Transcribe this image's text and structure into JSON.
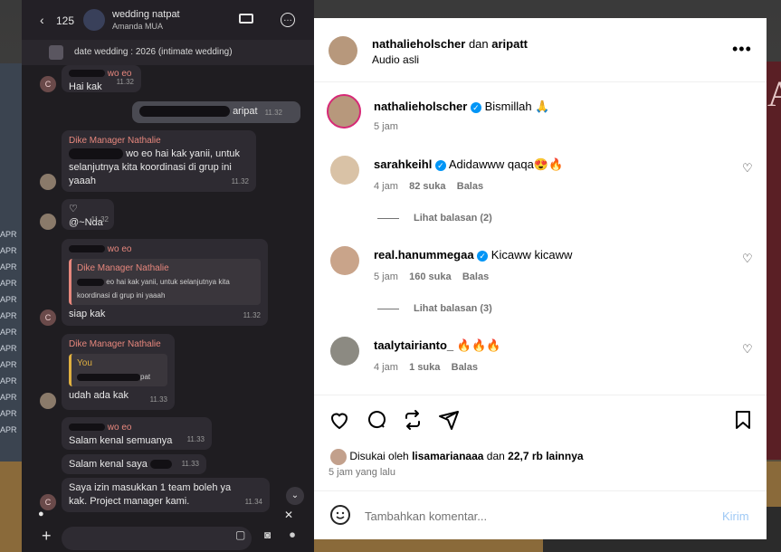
{
  "backdrop": {
    "left_letters": "APR\nAPR\nAPR\nAPR\nAPR\nAPR\nAPR\nAPR\nAPR\nAPR\nAPR\nAPR\nAPR",
    "right_letter": "A"
  },
  "chat": {
    "count": "125",
    "group_name": "wedding natpat",
    "group_sub": "Amanda MUA",
    "pinned": "date wedding :          2026 (intimate wedding)",
    "messages": [
      {
        "sender": "wo eo",
        "text": "Hai kak",
        "time": "11.32",
        "avatar": "C"
      },
      {
        "text": "aripat",
        "time": "11.32"
      },
      {
        "sender": "Dike Manager Nathalie",
        "text": "wo eo hai kak yanii, untuk selanjutnya kita koordinasi di grup ini yaaah",
        "time": "11.32"
      },
      {
        "text": "@~Nda",
        "time": "11.32"
      },
      {
        "sender": "wo eo",
        "quote_sender": "Dike Manager Nathalie",
        "quote_text": "eo hai kak yanii, untuk selanjutnya kita koordinasi di grup ini yaaah",
        "text": "siap kak",
        "time": "11.32",
        "avatar": "C"
      },
      {
        "sender": "Dike Manager Nathalie",
        "quote_sender": "You",
        "quote_text": "pat",
        "text": "udah ada kak",
        "time": "11.33"
      },
      {
        "sender": "wo eo",
        "text": "Salam kenal semuanya",
        "time": "11.33"
      },
      {
        "text": "Salam kenal saya",
        "time": "11.33"
      },
      {
        "text": "Saya izin masukkan 1 team boleh ya kak. Project manager kami.",
        "time": "11.34",
        "avatar": "C"
      }
    ]
  },
  "post": {
    "header": {
      "user1": "nathalieholscher",
      "joiner": "dan",
      "user2": "aripatt",
      "audio": "Audio asli"
    },
    "caption": {
      "user": "nathalieholscher",
      "text": "Bismillah 🙏",
      "time": "5 jam"
    },
    "comments": [
      {
        "user": "sarahkeihl",
        "verified": true,
        "text": "Adidawww qaqa😍🔥",
        "time": "4 jam",
        "likes": "82 suka",
        "reply": "Balas",
        "view_replies": "Lihat balasan (2)"
      },
      {
        "user": "real.hanummegaa",
        "verified": true,
        "text": "Kicaww kicaww",
        "time": "5 jam",
        "likes": "160 suka",
        "reply": "Balas",
        "view_replies": "Lihat balasan (3)"
      },
      {
        "user": "taalytairianto_",
        "verified": false,
        "text": "🔥🔥🔥",
        "time": "4 jam",
        "likes": "1 suka",
        "reply": "Balas"
      }
    ],
    "liked_by_prefix": "Disukai oleh",
    "liked_by_user": "lisamarianaaa",
    "liked_by_and": "dan",
    "liked_by_rest": "22,7 rb lainnya",
    "posted_ago": "5 jam yang lalu",
    "comment_placeholder": "Tambahkan komentar...",
    "post_button": "Kirim"
  },
  "icons": [
    "more-icon",
    "heart-icon",
    "comment-icon",
    "repost-icon",
    "share-icon",
    "bookmark-icon",
    "emoji-icon",
    "verified-icon"
  ]
}
